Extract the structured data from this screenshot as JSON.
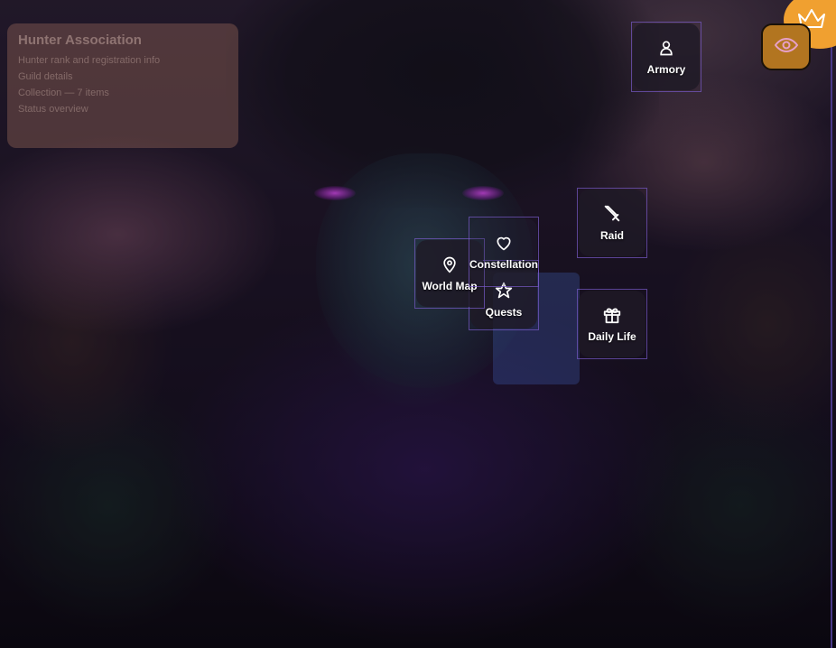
{
  "hunter_card": {
    "title": "Hunter Association",
    "lines": [
      "Hunter rank and registration info",
      "Guild details",
      "Collection — 7 items",
      "Status overview"
    ]
  },
  "nodes": {
    "armory": {
      "label": "Armory",
      "icon": "user-icon"
    },
    "raid": {
      "label": "Raid",
      "icon": "sword-icon"
    },
    "constellation": {
      "label": "Constellation",
      "icon": "heart-icon"
    },
    "world_map": {
      "label": "World Map",
      "icon": "map-pin-icon"
    },
    "quests": {
      "label": "Quests",
      "icon": "star-icon"
    },
    "daily_life": {
      "label": "Daily Life",
      "icon": "gift-icon"
    }
  },
  "controls": {
    "visibility_toggle_icon": "eye-icon",
    "premium_badge_icon": "crown-icon"
  },
  "colors": {
    "node_border": "#7a5ac8",
    "toggle_bg": "#b27520",
    "eye_icon": "#e7a0c8",
    "crown_badge": "#f0a030",
    "eye_glow": "#e050ff"
  }
}
